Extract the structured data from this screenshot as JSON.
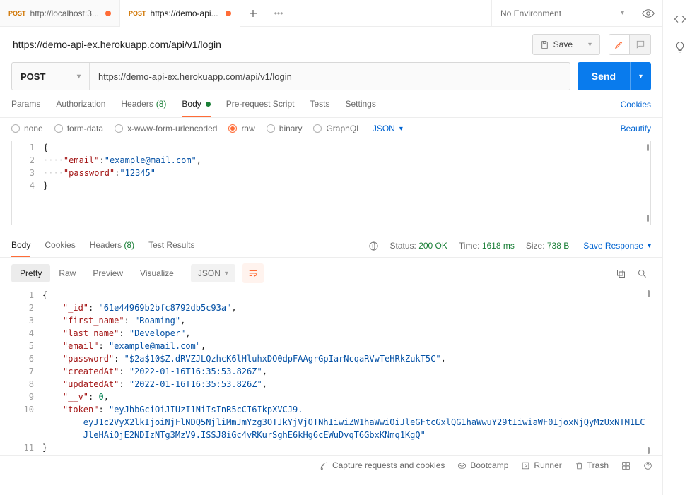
{
  "tabs": [
    {
      "method": "POST",
      "title": "http://localhost:3...",
      "dirty": true,
      "active": false
    },
    {
      "method": "POST",
      "title": "https://demo-api...",
      "dirty": true,
      "active": true
    }
  ],
  "environment": {
    "label": "No Environment"
  },
  "request": {
    "displayUrl": "https://demo-api-ex.herokuapp.com/api/v1/login",
    "method": "POST",
    "url": "https://demo-api-ex.herokuapp.com/api/v1/login",
    "saveLabel": "Save",
    "sendLabel": "Send"
  },
  "reqSubnav": {
    "params": "Params",
    "authorization": "Authorization",
    "headers": "Headers",
    "headersCount": "(8)",
    "body": "Body",
    "prerequest": "Pre-request Script",
    "tests": "Tests",
    "settings": "Settings",
    "cookies": "Cookies"
  },
  "bodyTypes": {
    "none": "none",
    "formdata": "form-data",
    "xwww": "x-www-form-urlencoded",
    "raw": "raw",
    "binary": "binary",
    "graphql": "GraphQL",
    "json": "JSON",
    "beautify": "Beautify"
  },
  "requestBody": {
    "email": "example@mail.com",
    "password": "12345"
  },
  "respNav": {
    "body": "Body",
    "cookies": "Cookies",
    "headers": "Headers",
    "headersCount": "(8)",
    "testResults": "Test Results"
  },
  "respStatus": {
    "statusLabel": "Status:",
    "statusValue": "200 OK",
    "timeLabel": "Time:",
    "timeValue": "1618 ms",
    "sizeLabel": "Size:",
    "sizeValue": "738 B",
    "saveResponse": "Save Response"
  },
  "respView": {
    "pretty": "Pretty",
    "raw": "Raw",
    "preview": "Preview",
    "visualize": "Visualize",
    "json": "JSON"
  },
  "responseBody": {
    "_id": "61e44969b2bfc8792db5c93a",
    "first_name": "Roaming",
    "last_name": "Developer",
    "email": "example@mail.com",
    "password": "$2a$10$Z.dRVZJLQzhcK6lHluhxDO0dpFAAgrGpIarNcqaRVwTeHRkZukT5C",
    "createdAt": "2022-01-16T16:35:53.826Z",
    "updatedAt": "2022-01-16T16:35:53.826Z",
    "__v": 0,
    "token_a": "eyJhbGciOiJIUzI1NiIsInR5cCI6IkpXVCJ9.",
    "token_b": "eyJ1c2VyX2lkIjoiNjFlNDQ5NjliMmJmYzg3OTJkYjVjOTNhIiwiZW1haWwiOiJleGFtcGxlQG1haWwuY29tIiwiaWF0IjoxNjQyMzUxNTM1LC",
    "token_c": "JleHAiOjE2NDIzNTg3MzV9.ISSJ8iGc4vRKurSghE6kHg6cEWuDvqT6GbxKNmq1KgQ"
  },
  "footer": {
    "capture": "Capture requests and cookies",
    "bootcamp": "Bootcamp",
    "runner": "Runner",
    "trash": "Trash"
  }
}
